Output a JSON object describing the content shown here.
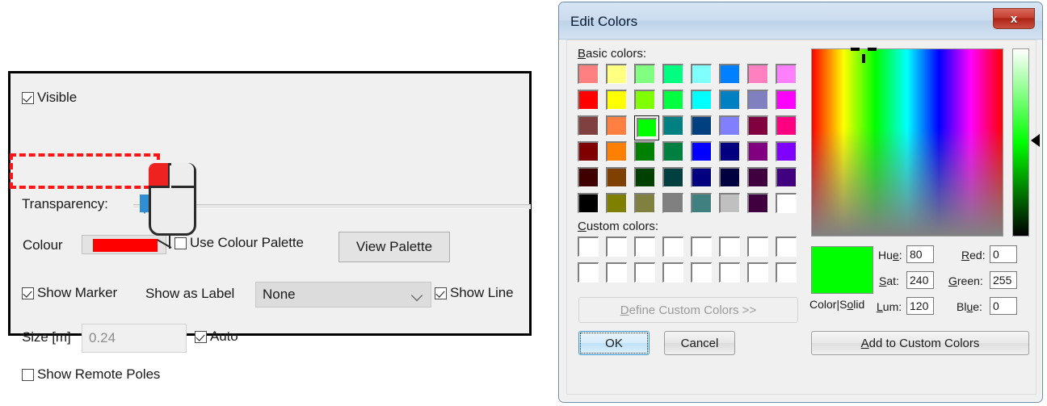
{
  "left_panel": {
    "visible": {
      "label": "Visible",
      "checked": true
    },
    "transparency": {
      "label": "Transparency:",
      "value": 0
    },
    "colour": {
      "label": "Colour",
      "swatch_color": "#ff0000"
    },
    "use_colour_palette": {
      "label": "Use Colour Palette",
      "checked": false
    },
    "view_palette_button": "View Palette",
    "show_marker": {
      "label": "Show Marker",
      "checked": true
    },
    "show_as_label": {
      "label": "Show as Label",
      "value": "None"
    },
    "show_line": {
      "label": "Show Line",
      "checked": true
    },
    "size": {
      "label": "Size [m]",
      "value": "0.24"
    },
    "auto": {
      "label": "Auto",
      "checked": true
    },
    "show_remote_poles": {
      "label": "Show Remote Poles",
      "checked": false
    },
    "highlight_color": "#ff1515",
    "cursor_icon": "mouse-left-click-icon"
  },
  "edit_colors": {
    "title": "Edit Colors",
    "close_label": "x",
    "basic_colors_label": "Basic colors:",
    "basic_colors_accel": "B",
    "custom_colors_label": "Custom colors:",
    "custom_colors_accel": "C",
    "basic_colors": [
      [
        "#ff8080",
        "#ffff80",
        "#80ff80",
        "#00ff80",
        "#80ffff",
        "#0080ff",
        "#ff80c0",
        "#ff80ff"
      ],
      [
        "#ff0000",
        "#ffff00",
        "#80ff00",
        "#00ff40",
        "#00ffff",
        "#0080c0",
        "#8080c0",
        "#ff00ff"
      ],
      [
        "#804040",
        "#ff8040",
        "#00ff00",
        "#008080",
        "#004080",
        "#8080ff",
        "#800040",
        "#ff0080"
      ],
      [
        "#800000",
        "#ff8000",
        "#008000",
        "#008040",
        "#0000ff",
        "#000080",
        "#800080",
        "#8000ff"
      ],
      [
        "#400000",
        "#804000",
        "#004000",
        "#004040",
        "#000080",
        "#000040",
        "#400040",
        "#400080"
      ],
      [
        "#000000",
        "#808000",
        "#808040",
        "#808080",
        "#408080",
        "#c0c0c0",
        "#400040",
        "#ffffff"
      ]
    ],
    "selected_basic_index": {
      "row": 2,
      "col": 2
    },
    "custom_colors": [
      [
        "#ffffff",
        "#ffffff",
        "#ffffff",
        "#ffffff",
        "#ffffff",
        "#ffffff",
        "#ffffff",
        "#ffffff"
      ],
      [
        "#ffffff",
        "#ffffff",
        "#ffffff",
        "#ffffff",
        "#ffffff",
        "#ffffff",
        "#ffffff",
        "#ffffff"
      ]
    ],
    "define_custom_colors_button": "Define Custom Colors >>",
    "define_custom_colors_accel": "D",
    "ok_button": "OK",
    "cancel_button": "Cancel",
    "add_to_custom_colors_button": "Add to Custom Colors",
    "add_to_custom_colors_accel": "A",
    "color_solid_label": "Color|Solid",
    "color_solid_value": "#00ff00",
    "fields": {
      "hue": {
        "label": "Hue:",
        "accel": "e",
        "value": "80"
      },
      "sat": {
        "label": "Sat:",
        "accel": "S",
        "value": "240"
      },
      "lum": {
        "label": "Lum:",
        "accel": "L",
        "value": "120"
      },
      "red": {
        "label": "Red:",
        "accel": "R",
        "value": "0"
      },
      "green": {
        "label": "Green:",
        "accel": "G",
        "value": "255"
      },
      "blue": {
        "label": "Blue:",
        "accel": "u",
        "value": "0"
      }
    }
  }
}
